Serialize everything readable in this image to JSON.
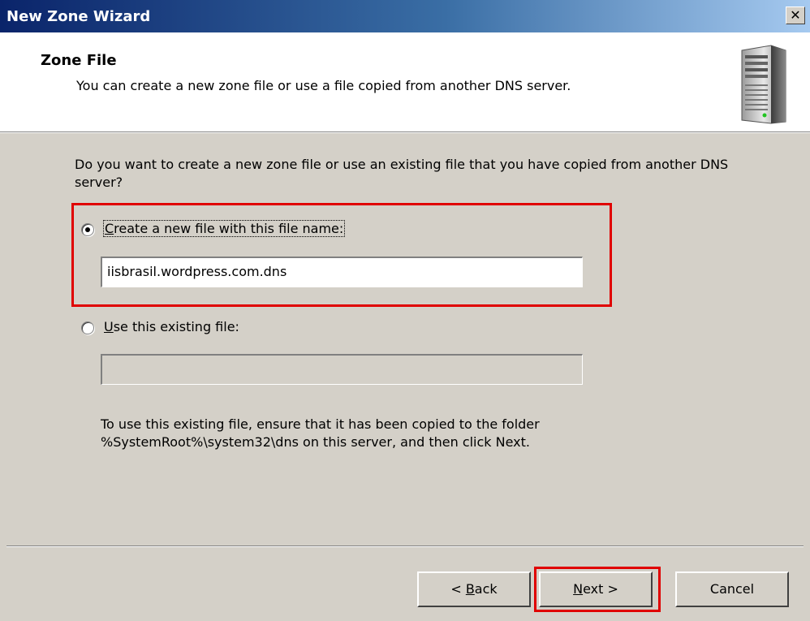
{
  "window": {
    "title": "New Zone Wizard",
    "close_glyph": "✕"
  },
  "header": {
    "title": "Zone File",
    "subtitle": "You can create a new zone file or use a file copied from another DNS server.",
    "icon": "server-icon"
  },
  "body": {
    "question": "Do you want to create a new zone file or use an existing file that you have copied from another DNS server?",
    "option_create": {
      "label_first": "C",
      "label_rest": "reate a new file with this file name:",
      "selected": true,
      "value": "iisbrasil.wordpress.com.dns"
    },
    "option_existing": {
      "label_first": "U",
      "label_rest": "se this existing file:",
      "selected": false,
      "value": ""
    },
    "info_line1": "To use this existing file, ensure that it has been copied to the folder",
    "info_line2": "%SystemRoot%\\system32\\dns on this server, and then click Next."
  },
  "buttons": {
    "back_prefix": "< ",
    "back_underline": "B",
    "back_rest": "ack",
    "next_underline": "N",
    "next_rest": "ext >",
    "cancel": "Cancel"
  },
  "colors": {
    "highlight": "#e00000",
    "titlebar_start": "#0a246a",
    "titlebar_end": "#a6caf0"
  }
}
